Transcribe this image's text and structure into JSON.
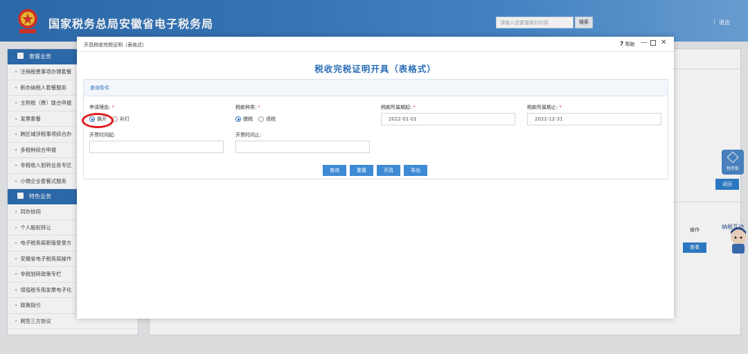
{
  "header": {
    "site_title": "国家税务总局安徽省电子税务局",
    "search_placeholder": "请输入您要搜索的内容",
    "search_label": "搜索",
    "logout_label": "退出"
  },
  "sidebar": {
    "section1_title": "套餐业务",
    "section1_items": [
      "注销税费事项办理套餐",
      "新办纳税人套餐服务",
      "主附税（费）联合申报",
      "发票套餐",
      "跨区域涉税事项综合办",
      "多税种综合申报",
      "非税收入划转业务专区",
      "小微企业套餐式服务"
    ],
    "section2_title": "特色业务",
    "section2_items": [
      "同办协同",
      "个人股权转让",
      "电子税务局新版登录方",
      "安徽省电子税务局操作",
      "非税划转政策专栏",
      "增值税专用发票电子化",
      "政策指引",
      "网签三方协议"
    ]
  },
  "background": {
    "op_col_label": "操作",
    "view_label": "查看",
    "return_label": "返回",
    "side_tool_label": "税老板",
    "mascot_text": "纳税互动"
  },
  "dialog": {
    "title": "开具税收完税证明（表格式）",
    "help_label": "帮助",
    "form_title": "税收完税证明开具（表格式）",
    "cond_title": "查询条件",
    "reason": {
      "label": "申请理由:",
      "options": [
        "换开",
        "补打"
      ],
      "selected": "换开"
    },
    "tax_type": {
      "label": "税款种类:",
      "options": [
        "缴税",
        "退税"
      ],
      "selected": "缴税"
    },
    "period_start": {
      "label": "税款所属期起:",
      "value": "2022-01-01"
    },
    "period_end": {
      "label": "税款所属期止:",
      "value": "2022-12-31"
    },
    "issue_start": {
      "label": "开票时间起:",
      "value": ""
    },
    "issue_end": {
      "label": "开票时间止:",
      "value": ""
    },
    "required_mark": "*",
    "buttons": [
      "查询",
      "重置",
      "开具",
      "导出"
    ]
  },
  "colors": {
    "header_blue": "#2f6fb3",
    "title_blue": "#2a6db8",
    "button_blue": "#3e8ad4",
    "highlight_red": "#e01a1a"
  }
}
